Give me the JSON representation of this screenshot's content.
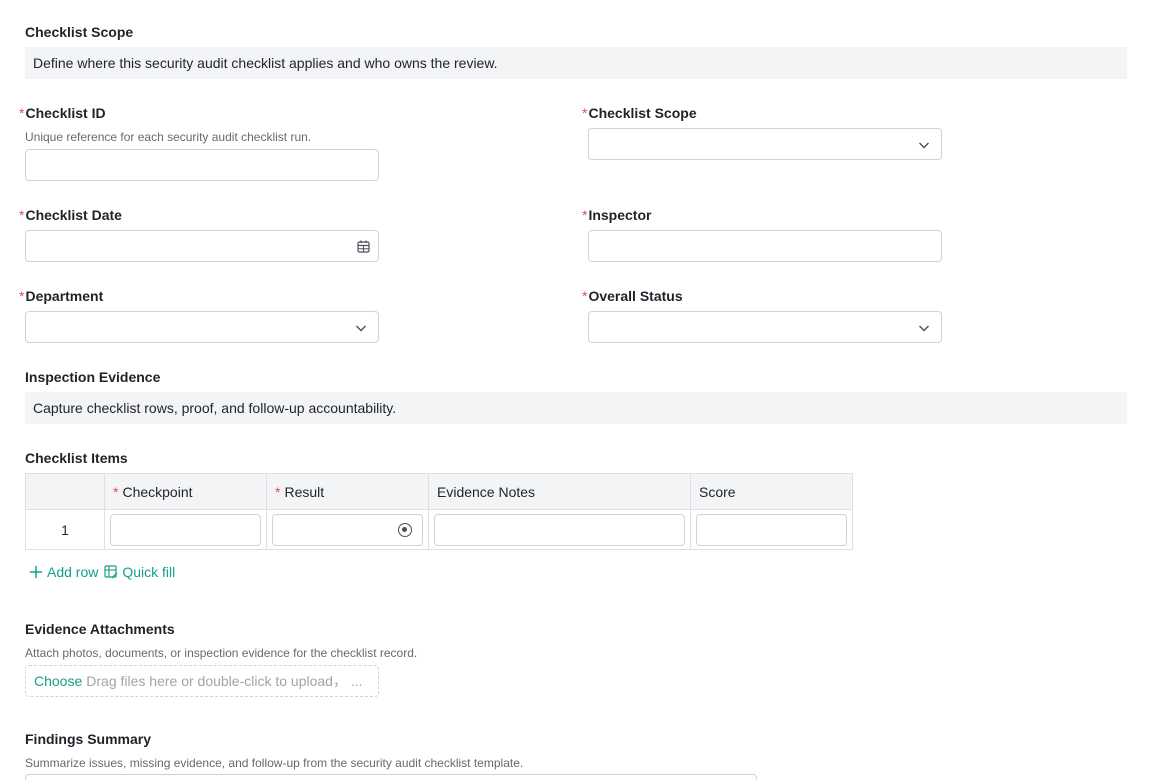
{
  "scope": {
    "title": "Checklist Scope",
    "description": "Define where this security audit checklist applies and who owns the review."
  },
  "fields": {
    "checklist_id": {
      "label": "Checklist ID",
      "hint": "Unique reference for each security audit checklist run.",
      "value": ""
    },
    "checklist_scope": {
      "label": "Checklist Scope",
      "value": ""
    },
    "checklist_date": {
      "label": "Checklist Date",
      "value": ""
    },
    "inspector": {
      "label": "Inspector",
      "value": ""
    },
    "department": {
      "label": "Department",
      "value": ""
    },
    "overall_status": {
      "label": "Overall Status",
      "value": ""
    },
    "required_mark": "*"
  },
  "evidence": {
    "title": "Inspection Evidence",
    "description": "Capture checklist rows, proof, and follow-up accountability."
  },
  "checklist_items": {
    "title": "Checklist Items",
    "columns": [
      "Checkpoint",
      "Result",
      "Evidence Notes",
      "Score"
    ],
    "rows": [
      {
        "index": "1"
      }
    ],
    "add_row": "Add row",
    "quick_fill": "Quick fill"
  },
  "attachments": {
    "label": "Evidence Attachments",
    "hint": "Attach photos, documents, or inspection evidence for the checklist record.",
    "choose": "Choose",
    "drag_text": "Drag files here or double-click to upload， ..."
  },
  "findings": {
    "label": "Findings Summary",
    "hint": "Summarize issues, missing evidence, and follow-up from the security audit checklist template."
  },
  "colors": {
    "accent": "#14a085",
    "required": "#e34d59",
    "border": "#d0d3d6",
    "band": "#f3f4f6"
  },
  "icons": {
    "select": "chevron-down-icon",
    "date": "calendar-icon",
    "radio": "radio-icon",
    "add": "plus-icon",
    "quick_fill": "edit-table-icon"
  }
}
